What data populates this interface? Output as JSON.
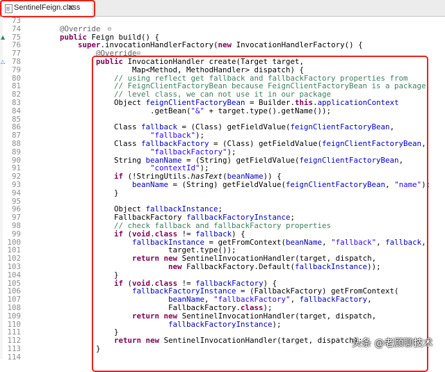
{
  "tab": {
    "filename": "SentinelFeign.class",
    "close_glyph": "✕",
    "file_icon": "class-file-icon"
  },
  "colors": {
    "highlight": "#e8221c",
    "keyword": "#7f0055",
    "string": "#2a00ff",
    "comment": "#3f7f5f",
    "annotation": "#646464"
  },
  "watermark": "头条 @老顾聊技术",
  "lines": [
    {
      "n": "73",
      "segs": []
    },
    {
      "n": "74",
      "segs": [
        {
          "t": "    @Override",
          "c": "ann"
        }
      ],
      "fold": "⊖"
    },
    {
      "n": "75",
      "segs": [
        {
          "t": "    "
        },
        {
          "t": "public",
          "c": "kw"
        },
        {
          "t": " Feign build() {"
        }
      ],
      "marker": "▲"
    },
    {
      "n": "76",
      "segs": [
        {
          "t": "        "
        },
        {
          "t": "super",
          "c": "kw"
        },
        {
          "t": ".invocationHandlerFactory("
        },
        {
          "t": "new",
          "c": "kw"
        },
        {
          "t": " InvocationHandlerFactory() {"
        }
      ]
    },
    {
      "n": "77",
      "segs": [
        {
          "t": "            @Override",
          "c": "ann"
        }
      ],
      "fold": "⊖"
    },
    {
      "n": "78",
      "segs": [
        {
          "t": "            "
        },
        {
          "t": "public",
          "c": "kw"
        },
        {
          "t": " InvocationHandler create(Target target,"
        }
      ],
      "marker": "△"
    },
    {
      "n": "79",
      "segs": [
        {
          "t": "                    Map<Method, MethodHandler> dispatch) {"
        }
      ]
    },
    {
      "n": "80",
      "segs": [
        {
          "t": "                "
        },
        {
          "t": "// using reflect get fallback and fallbackFactory properties from",
          "c": "cmt"
        }
      ]
    },
    {
      "n": "81",
      "segs": [
        {
          "t": "                "
        },
        {
          "t": "// FeignClientFactoryBean because FeignClientFactoryBean is a package",
          "c": "cmt"
        }
      ]
    },
    {
      "n": "82",
      "segs": [
        {
          "t": "                "
        },
        {
          "t": "// level class, we can not use it in our package",
          "c": "cmt"
        }
      ]
    },
    {
      "n": "83",
      "segs": [
        {
          "t": "                Object "
        },
        {
          "t": "feignClientFactoryBean",
          "c": "fld"
        },
        {
          "t": " = Builder."
        },
        {
          "t": "this",
          "c": "kw"
        },
        {
          "t": "."
        },
        {
          "t": "applicationContext",
          "c": "fld"
        }
      ]
    },
    {
      "n": "84",
      "segs": [
        {
          "t": "                        .getBean("
        },
        {
          "t": "\"&\"",
          "c": "str"
        },
        {
          "t": " + target.type().getName());"
        }
      ]
    },
    {
      "n": "85",
      "segs": []
    },
    {
      "n": "86",
      "segs": [
        {
          "t": "                Class "
        },
        {
          "t": "fallback",
          "c": "fld"
        },
        {
          "t": " = (Class) getFieldValue("
        },
        {
          "t": "feignClientFactoryBean",
          "c": "fld"
        },
        {
          "t": ","
        }
      ]
    },
    {
      "n": "87",
      "segs": [
        {
          "t": "                        "
        },
        {
          "t": "\"fallback\"",
          "c": "str"
        },
        {
          "t": ");"
        }
      ]
    },
    {
      "n": "88",
      "segs": [
        {
          "t": "                Class "
        },
        {
          "t": "fallbackFactory",
          "c": "fld"
        },
        {
          "t": " = (Class) getFieldValue("
        },
        {
          "t": "feignClientFactoryBean",
          "c": "fld"
        },
        {
          "t": ","
        }
      ]
    },
    {
      "n": "89",
      "segs": [
        {
          "t": "                        "
        },
        {
          "t": "\"fallbackFactory\"",
          "c": "str"
        },
        {
          "t": ");"
        }
      ]
    },
    {
      "n": "90",
      "segs": [
        {
          "t": "                String "
        },
        {
          "t": "beanName",
          "c": "fld"
        },
        {
          "t": " = (String) getFieldValue("
        },
        {
          "t": "feignClientFactoryBean",
          "c": "fld"
        },
        {
          "t": ","
        }
      ]
    },
    {
      "n": "91",
      "segs": [
        {
          "t": "                        "
        },
        {
          "t": "\"contextId\"",
          "c": "str"
        },
        {
          "t": ");"
        }
      ]
    },
    {
      "n": "92",
      "segs": [
        {
          "t": "                "
        },
        {
          "t": "if",
          "c": "kw"
        },
        {
          "t": " (!StringUtils."
        },
        {
          "t": "hasText",
          "c": "sta"
        },
        {
          "t": "("
        },
        {
          "t": "beanName",
          "c": "fld"
        },
        {
          "t": ")) {"
        }
      ]
    },
    {
      "n": "93",
      "segs": [
        {
          "t": "                    "
        },
        {
          "t": "beanName",
          "c": "fld"
        },
        {
          "t": " = (String) getFieldValue("
        },
        {
          "t": "feignClientFactoryBean",
          "c": "fld"
        },
        {
          "t": ", "
        },
        {
          "t": "\"name\"",
          "c": "str"
        },
        {
          "t": ");"
        }
      ]
    },
    {
      "n": "94",
      "segs": [
        {
          "t": "                }"
        }
      ]
    },
    {
      "n": "95",
      "segs": []
    },
    {
      "n": "96",
      "segs": [
        {
          "t": "                Object "
        },
        {
          "t": "fallbackInstance",
          "c": "fld"
        },
        {
          "t": ";"
        }
      ]
    },
    {
      "n": "97",
      "segs": [
        {
          "t": "                FallbackFactory "
        },
        {
          "t": "fallbackFactoryInstance",
          "c": "fld"
        },
        {
          "t": ";"
        }
      ]
    },
    {
      "n": "98",
      "segs": [
        {
          "t": "                "
        },
        {
          "t": "// check fallback and fallbackFactory properties",
          "c": "cmt"
        }
      ]
    },
    {
      "n": "99",
      "segs": [
        {
          "t": "                "
        },
        {
          "t": "if",
          "c": "kw"
        },
        {
          "t": " ("
        },
        {
          "t": "void",
          "c": "kw"
        },
        {
          "t": "."
        },
        {
          "t": "class",
          "c": "kw"
        },
        {
          "t": " != "
        },
        {
          "t": "fallback",
          "c": "fld"
        },
        {
          "t": ") {"
        }
      ]
    },
    {
      "n": "100",
      "segs": [
        {
          "t": "                    "
        },
        {
          "t": "fallbackInstance",
          "c": "fld"
        },
        {
          "t": " = getFromContext("
        },
        {
          "t": "beanName",
          "c": "fld"
        },
        {
          "t": ", "
        },
        {
          "t": "\"fallback\"",
          "c": "str"
        },
        {
          "t": ", "
        },
        {
          "t": "fallback",
          "c": "fld"
        },
        {
          "t": ","
        }
      ]
    },
    {
      "n": "101",
      "segs": [
        {
          "t": "                            target.type());"
        }
      ]
    },
    {
      "n": "102",
      "segs": [
        {
          "t": "                    "
        },
        {
          "t": "return",
          "c": "kw"
        },
        {
          "t": " "
        },
        {
          "t": "new",
          "c": "kw"
        },
        {
          "t": " SentinelInvocationHandler(target, dispatch,"
        }
      ]
    },
    {
      "n": "103",
      "segs": [
        {
          "t": "                            "
        },
        {
          "t": "new",
          "c": "kw"
        },
        {
          "t": " FallbackFactory.Default("
        },
        {
          "t": "fallbackInstance",
          "c": "fld"
        },
        {
          "t": "));"
        }
      ]
    },
    {
      "n": "104",
      "segs": [
        {
          "t": "                }"
        }
      ]
    },
    {
      "n": "105",
      "segs": [
        {
          "t": "                "
        },
        {
          "t": "if",
          "c": "kw"
        },
        {
          "t": " ("
        },
        {
          "t": "void",
          "c": "kw"
        },
        {
          "t": "."
        },
        {
          "t": "class",
          "c": "kw"
        },
        {
          "t": " != "
        },
        {
          "t": "fallbackFactory",
          "c": "fld"
        },
        {
          "t": ") {"
        }
      ]
    },
    {
      "n": "106",
      "segs": [
        {
          "t": "                    "
        },
        {
          "t": "fallbackFactoryInstance",
          "c": "fld"
        },
        {
          "t": " = (FallbackFactory) getFromContext("
        }
      ]
    },
    {
      "n": "107",
      "segs": [
        {
          "t": "                            "
        },
        {
          "t": "beanName",
          "c": "fld"
        },
        {
          "t": ", "
        },
        {
          "t": "\"fallbackFactory\"",
          "c": "str"
        },
        {
          "t": ", "
        },
        {
          "t": "fallbackFactory",
          "c": "fld"
        },
        {
          "t": ","
        }
      ]
    },
    {
      "n": "108",
      "segs": [
        {
          "t": "                            FallbackFactory."
        },
        {
          "t": "class",
          "c": "kw"
        },
        {
          "t": ");"
        }
      ]
    },
    {
      "n": "109",
      "segs": [
        {
          "t": "                    "
        },
        {
          "t": "return",
          "c": "kw"
        },
        {
          "t": " "
        },
        {
          "t": "new",
          "c": "kw"
        },
        {
          "t": " SentinelInvocationHandler(target, dispatch,"
        }
      ]
    },
    {
      "n": "110",
      "segs": [
        {
          "t": "                            "
        },
        {
          "t": "fallbackFactoryInstance",
          "c": "fld"
        },
        {
          "t": ");"
        }
      ]
    },
    {
      "n": "111",
      "segs": [
        {
          "t": "                }"
        }
      ]
    },
    {
      "n": "112",
      "segs": [
        {
          "t": "                "
        },
        {
          "t": "return",
          "c": "kw"
        },
        {
          "t": " "
        },
        {
          "t": "new",
          "c": "kw"
        },
        {
          "t": " SentinelInvocationHandler(target, dispatch);"
        }
      ]
    },
    {
      "n": "113",
      "segs": [
        {
          "t": "            }"
        }
      ]
    },
    {
      "n": "114",
      "segs": []
    }
  ]
}
